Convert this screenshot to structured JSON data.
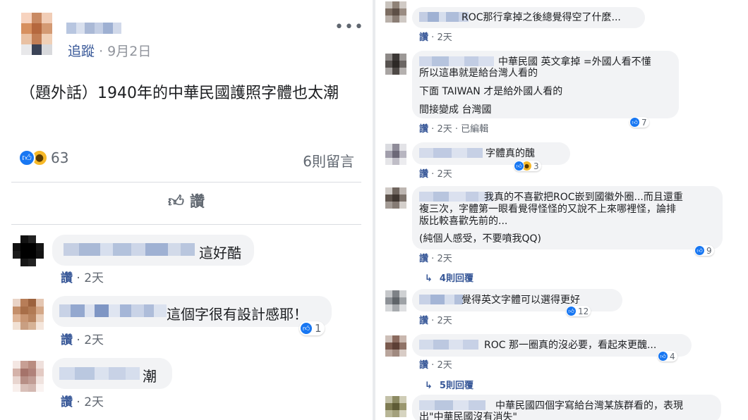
{
  "post": {
    "follow_label": "追蹤",
    "dot": "·",
    "date": "9月2日",
    "more_label": "•••",
    "text": "（題外話）1940年的中華民國護照字體也太潮",
    "reaction_count": "63",
    "comment_count_label": "6則留言",
    "like_label": "讚",
    "like_icon": "thumbs-up-icon"
  },
  "left_comments": [
    {
      "text": "這好酷",
      "like": "讚",
      "time": "2天",
      "reactions": null
    },
    {
      "text": "這個字很有設計感耶！",
      "like": "讚",
      "time": "2天",
      "reactions": "1"
    },
    {
      "text": "潮",
      "like": "讚",
      "time": "2天",
      "reactions": null
    }
  ],
  "right_comments": [
    {
      "lines": [
        "ROC那行拿掉之後總覺得空了什麼..."
      ],
      "like": "讚",
      "time": "2天",
      "edited": "",
      "reactions": ""
    },
    {
      "lines": [
        "中華民國 英文拿掉 =外國人看不懂",
        "所以這串就是給台灣人看的",
        "下面 TAIWAN 才是給外國人看的",
        "間接變成 台灣國"
      ],
      "like": "讚",
      "time": "2天",
      "edited": "已編輯",
      "reactions": "7"
    },
    {
      "lines": [
        "字體真的醜"
      ],
      "like": "讚",
      "time": "2天",
      "edited": "",
      "reactions": "3"
    },
    {
      "lines": [
        "我真的不喜歡把ROC嵌到國徽外圈...而且還重",
        "複三次，字體第一眼看覺得怪怪的又說不上來哪裡怪，論排",
        "版比較喜歡先前的...",
        "(純個人感受，不要噴我QQ)"
      ],
      "like": "讚",
      "time": "2天",
      "edited": "",
      "reactions": "9"
    },
    {
      "lines": [
        "覺得英文字體可以選得更好"
      ],
      "like": "讚",
      "time": "2天",
      "edited": "",
      "reactions": "12"
    },
    {
      "lines": [
        "ROC 那一圈真的沒必要，看起來更醜..."
      ],
      "like": "讚",
      "time": "2天",
      "edited": "",
      "reactions": "4"
    },
    {
      "lines": [
        "中華民國四個字寫給台灣某族群看的，表現",
        "出\"中華民國沒有消失\""
      ],
      "like": "",
      "time": "",
      "edited": "",
      "reactions": ""
    }
  ],
  "reply_links": [
    "4則回覆",
    "5則回覆"
  ],
  "separator": "·",
  "colors": {
    "accent": "#385898",
    "like_blue": "#1877f2",
    "wow_yellow": "#f7b928",
    "bubble": "#f2f3f5",
    "meta_gray": "#606770"
  }
}
